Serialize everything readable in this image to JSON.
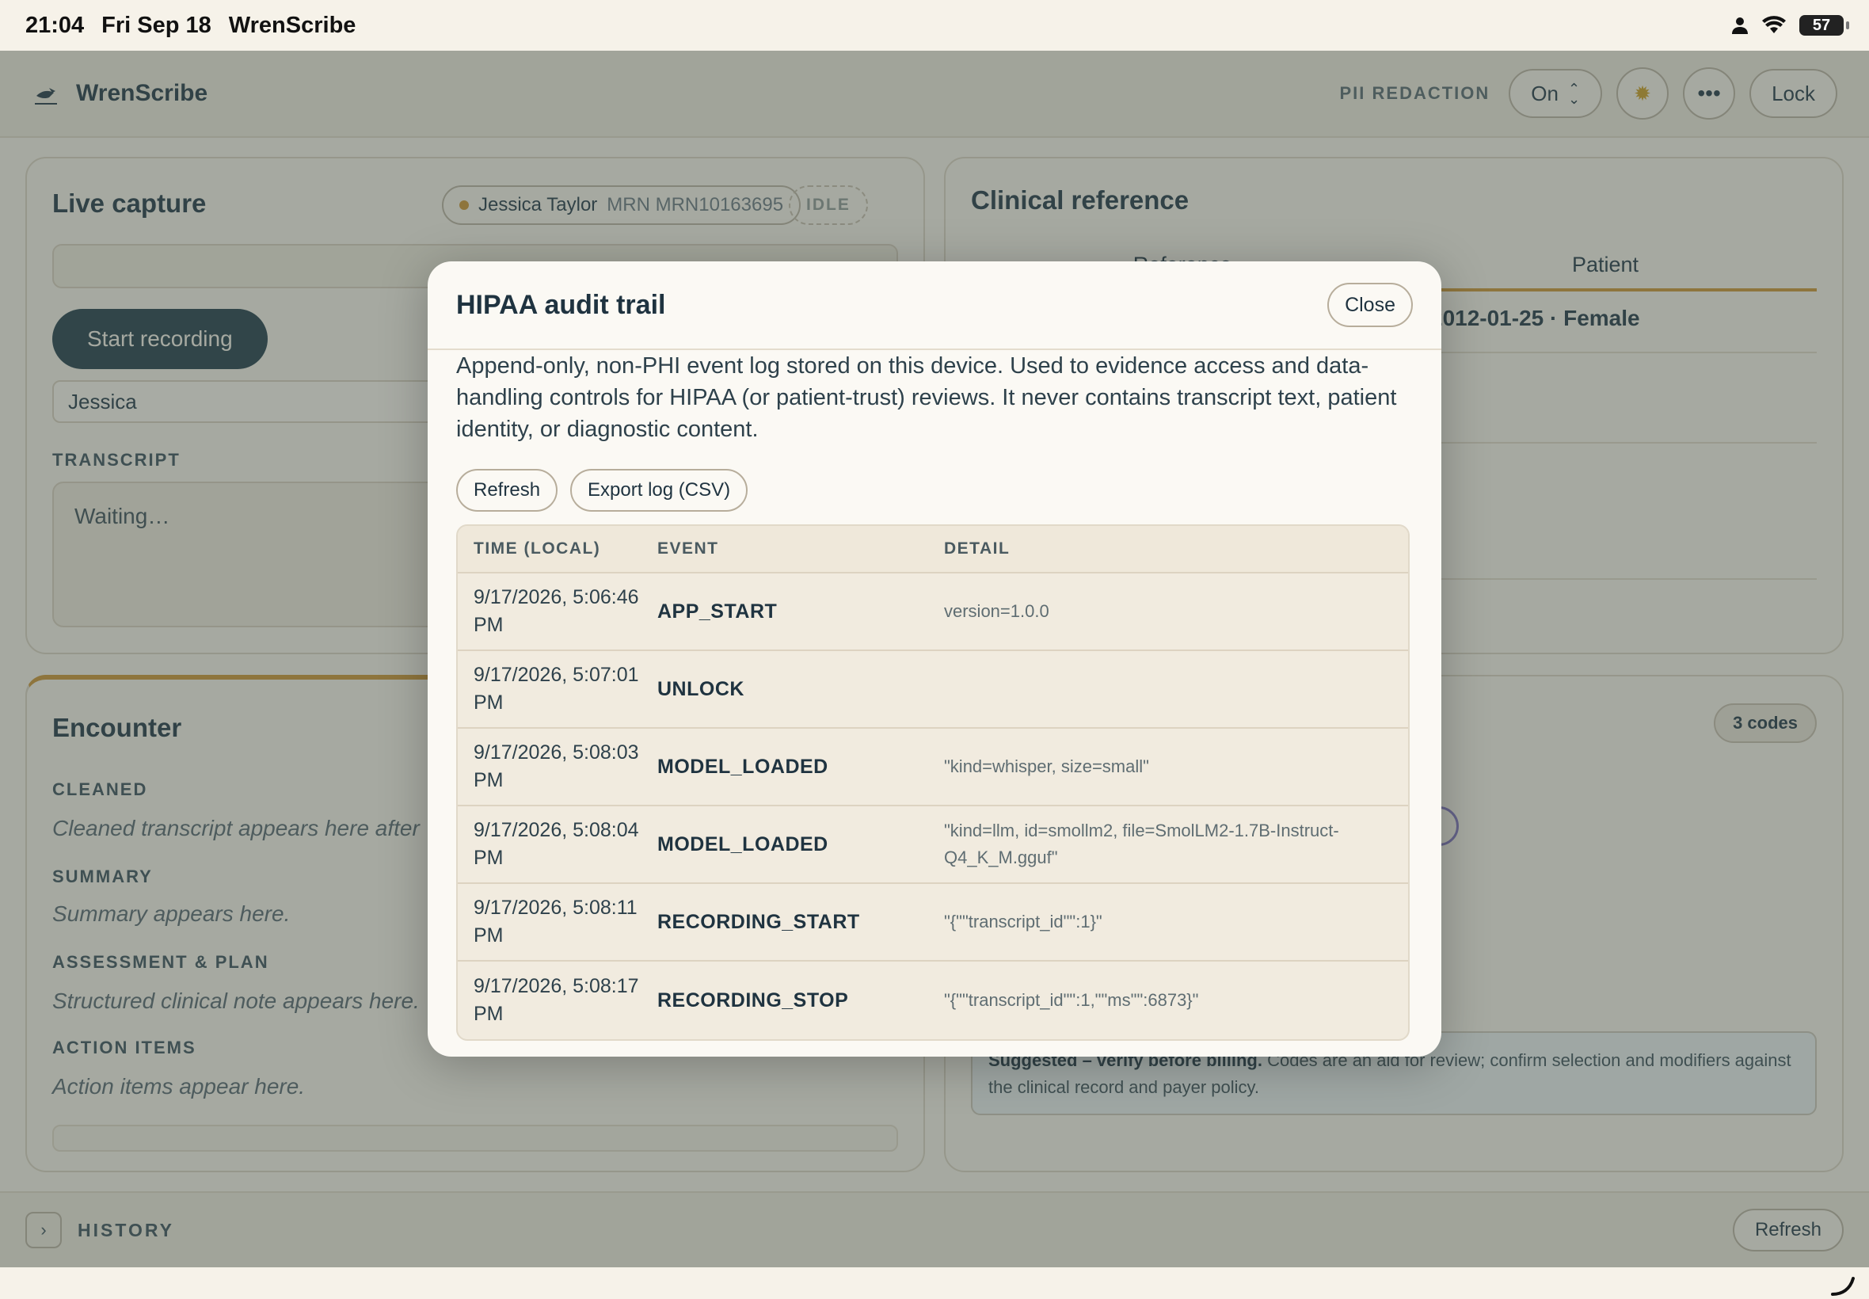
{
  "status_bar": {
    "time": "21:04",
    "date": "Fri Sep 18",
    "app": "WrenScribe",
    "battery": "57"
  },
  "header": {
    "brand": "WrenScribe",
    "pii_label": "PII REDACTION",
    "pii_value": "On",
    "theme_icon": "sun-icon",
    "more_icon": "more-icon",
    "lock_label": "Lock"
  },
  "live_capture": {
    "title": "Live capture",
    "patient_name": "Jessica Taylor",
    "mrn": "MRN MRN10163695",
    "state": "IDLE",
    "start_label": "Start recording",
    "name_value": "Jessica",
    "transcript_label": "TRANSCRIPT",
    "transcript_placeholder": "Waiting…"
  },
  "clinical_reference": {
    "title": "Clinical reference",
    "tabs": [
      "Reference",
      "Patient"
    ],
    "patient_line": "2012-01-25 · Female"
  },
  "encounter": {
    "title": "Encounter",
    "sections": [
      {
        "label": "CLEANED",
        "text": "Cleaned transcript appears here after"
      },
      {
        "label": "SUMMARY",
        "text": "Summary appears here."
      },
      {
        "label": "ASSESSMENT & PLAN",
        "text": "Structured clinical note appears here."
      },
      {
        "label": "ACTION ITEMS",
        "text": "Action items appear here."
      }
    ]
  },
  "codes": {
    "badge": "3 codes",
    "notice_strong": "Suggested – verify before billing.",
    "notice_text": " Codes are an aid for review; confirm selection and modifiers against the clinical record and payer policy."
  },
  "history": {
    "label": "HISTORY",
    "refresh_label": "Refresh"
  },
  "modal": {
    "title": "HIPAA audit trail",
    "close_label": "Close",
    "description": "Append-only, non-PHI event log stored on this device. Used to evidence access and data-handling controls for HIPAA (or patient-trust) reviews. It never contains transcript text, patient identity, or diagnostic content.",
    "refresh_label": "Refresh",
    "export_label": "Export log (CSV)",
    "columns": [
      "TIME (LOCAL)",
      "EVENT",
      "DETAIL"
    ],
    "rows": [
      {
        "time": "9/17/2026, 5:06:46 PM",
        "event": "APP_START",
        "detail": "version=1.0.0"
      },
      {
        "time": "9/17/2026, 5:07:01 PM",
        "event": "UNLOCK",
        "detail": ""
      },
      {
        "time": "9/17/2026, 5:08:03 PM",
        "event": "MODEL_LOADED",
        "detail": "\"kind=whisper, size=small\""
      },
      {
        "time": "9/17/2026, 5:08:04 PM",
        "event": "MODEL_LOADED",
        "detail": "\"kind=llm, id=smollm2, file=SmolLM2-1.7B-Instruct-Q4_K_M.gguf\""
      },
      {
        "time": "9/17/2026, 5:08:11 PM",
        "event": "RECORDING_START",
        "detail": "\"{\"\"transcript_id\"\":1}\""
      },
      {
        "time": "9/17/2026, 5:08:17 PM",
        "event": "RECORDING_STOP",
        "detail": "\"{\"\"transcript_id\"\":1,\"\"ms\"\":6873}\""
      }
    ]
  }
}
